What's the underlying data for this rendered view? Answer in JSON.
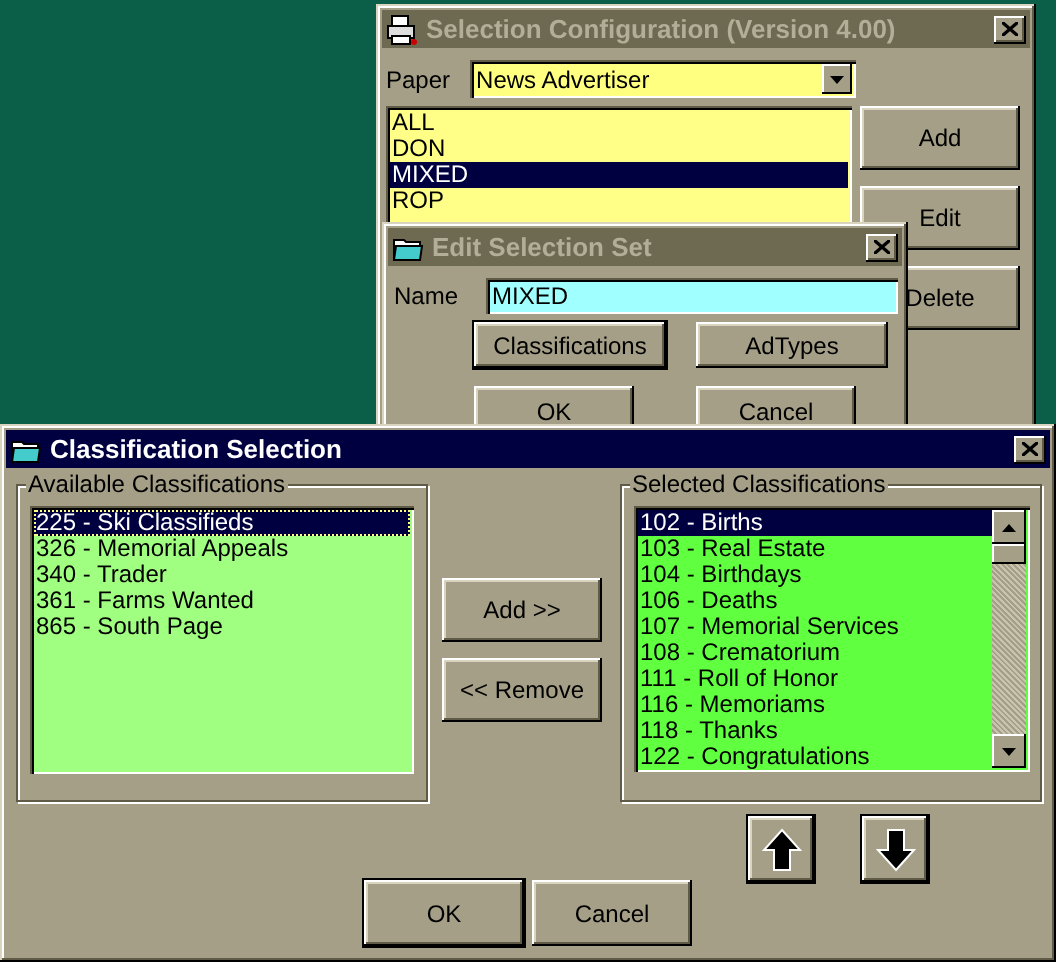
{
  "config_window": {
    "title": "Selection Configuration (Version 4.00)",
    "active": false,
    "paper_label": "Paper",
    "paper_value": "News Advertiser",
    "sets": [
      {
        "label": "ALL",
        "selected": false
      },
      {
        "label": "DON",
        "selected": false
      },
      {
        "label": "MIXED",
        "selected": true
      },
      {
        "label": "ROP",
        "selected": false
      }
    ],
    "buttons": [
      {
        "label": "Add",
        "default": false
      },
      {
        "label": "Edit",
        "default": false
      },
      {
        "label": "Delete",
        "default": false
      }
    ]
  },
  "edit_window": {
    "title": "Edit Selection Set",
    "active": false,
    "name_label": "Name",
    "name_value": "MIXED",
    "buttons": [
      {
        "label": "Classifications",
        "default": true
      },
      {
        "label": "AdTypes",
        "default": false
      },
      {
        "label": "OK",
        "default": false
      },
      {
        "label": "Cancel",
        "default": false
      }
    ]
  },
  "classification_window": {
    "title": "Classification Selection",
    "active": true,
    "available": {
      "label": "Available Classifications",
      "items": [
        {
          "label": "225 - Ski Classifieds",
          "selected": true
        },
        {
          "label": "326 - Memorial Appeals",
          "selected": false
        },
        {
          "label": "340 - Trader",
          "selected": false
        },
        {
          "label": "361 - Farms Wanted",
          "selected": false
        },
        {
          "label": "865 - South Page",
          "selected": false
        }
      ]
    },
    "move_buttons": [
      {
        "label": "Add >>",
        "default": false
      },
      {
        "label": "<< Remove",
        "default": false
      }
    ],
    "chosen": {
      "label": "Selected Classifications",
      "items": [
        {
          "label": "102 - Births",
          "selected": true
        },
        {
          "label": "103 - Real Estate",
          "selected": false
        },
        {
          "label": "104 - Birthdays",
          "selected": false
        },
        {
          "label": "106 - Deaths",
          "selected": false
        },
        {
          "label": "107 - Memorial Services",
          "selected": false
        },
        {
          "label": "108 - Crematorium",
          "selected": false
        },
        {
          "label": "111 - Roll of Honor",
          "selected": false
        },
        {
          "label": "116 - Memoriams",
          "selected": false
        },
        {
          "label": "118 - Thanks",
          "selected": false
        },
        {
          "label": "122 - Congratulations",
          "selected": false
        }
      ]
    },
    "buttons": [
      {
        "label": "OK",
        "default": true
      },
      {
        "label": "Cancel",
        "default": false
      }
    ]
  }
}
